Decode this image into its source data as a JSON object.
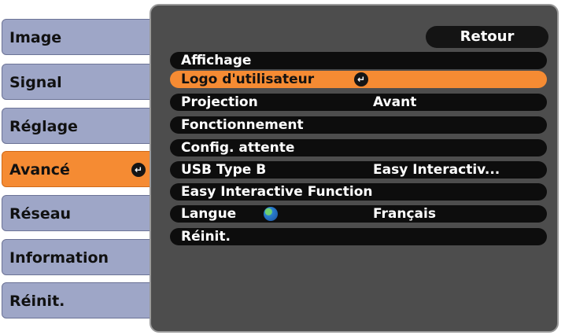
{
  "tabs": [
    {
      "label": "Image",
      "active": false
    },
    {
      "label": "Signal",
      "active": false
    },
    {
      "label": "Réglage",
      "active": false
    },
    {
      "label": "Avancé",
      "active": true
    },
    {
      "label": "Réseau",
      "active": false
    },
    {
      "label": "Information",
      "active": false
    },
    {
      "label": "Réinit.",
      "active": false
    }
  ],
  "panel": {
    "back_label": "Retour",
    "items": [
      {
        "label": "Affichage",
        "value": ""
      },
      {
        "label": "Logo d'utilisateur",
        "value": "",
        "selected": true
      },
      {
        "label": "Projection",
        "value": "Avant"
      },
      {
        "label": "Fonctionnement",
        "value": ""
      },
      {
        "label": "Config. attente",
        "value": ""
      },
      {
        "label": "USB Type B",
        "value": "Easy Interactiv..."
      },
      {
        "label": "Easy Interactive Function",
        "value": ""
      },
      {
        "label": "Langue",
        "value": "Français",
        "icon": "globe-icon"
      },
      {
        "label": "Réinit.",
        "value": ""
      }
    ]
  },
  "colors": {
    "accent": "#f58b33",
    "tab": "#9ea6c7",
    "panel": "#4d4d4d",
    "bar": "#0d0d0d"
  },
  "icons": {
    "enter": "enter-icon",
    "language": "globe-icon"
  }
}
